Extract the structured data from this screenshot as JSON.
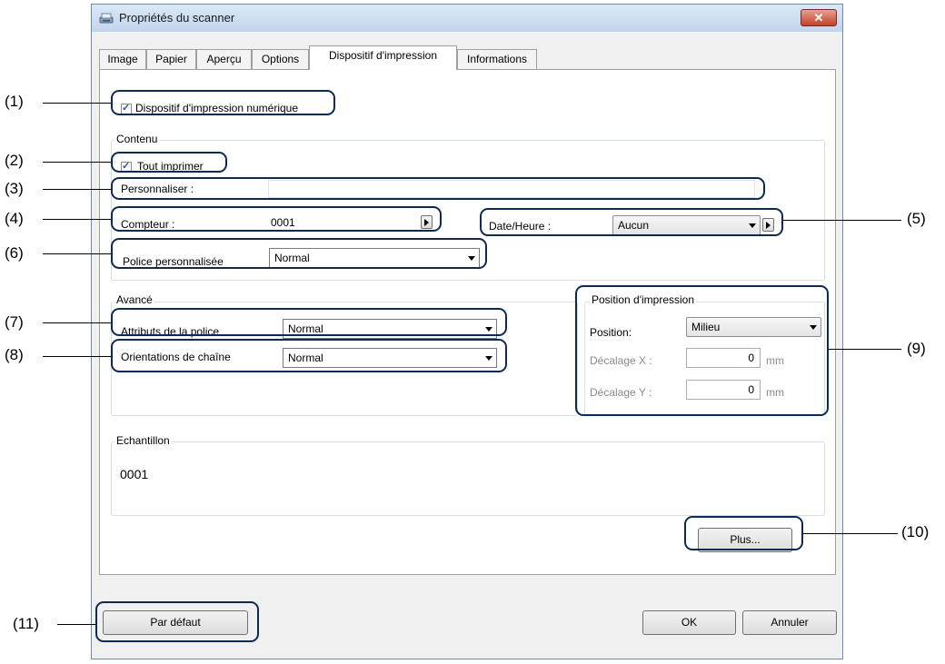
{
  "window": {
    "title": "Propriétés du scanner",
    "close_glyph": "✕"
  },
  "tabs": [
    "Image",
    "Papier",
    "Aperçu",
    "Options",
    "Dispositif d'impression",
    "Informations"
  ],
  "digital_printer": {
    "label": "Dispositif d'impression numérique",
    "checked": true
  },
  "contenu": {
    "title": "Contenu",
    "print_all": {
      "label": "Tout imprimer",
      "checked": true
    },
    "customize": {
      "label": "Personnaliser :",
      "value": ""
    },
    "counter": {
      "label": "Compteur :",
      "value": "0001"
    },
    "datetime": {
      "label": "Date/Heure :",
      "value": "Aucun"
    },
    "custom_font": {
      "label": "Police personnalisée",
      "value": "Normal"
    }
  },
  "avance": {
    "title": "Avancé",
    "font_attributes": {
      "label": "Attributs de la police",
      "value": "Normal"
    },
    "string_orientation": {
      "label": "Orientations de chaîne",
      "value": "Normal"
    }
  },
  "print_position": {
    "title": "Position d'impression",
    "position": {
      "label": "Position:",
      "value": "Milieu"
    },
    "offset_x": {
      "label": "Décalage X :",
      "value": "0",
      "unit": "mm"
    },
    "offset_y": {
      "label": "Décalage Y :",
      "value": "0",
      "unit": "mm"
    }
  },
  "sample": {
    "title": "Echantillon",
    "value": "0001"
  },
  "buttons": {
    "more": "Plus...",
    "default": "Par défaut",
    "ok": "OK",
    "cancel": "Annuler"
  },
  "callouts": [
    "(1)",
    "(2)",
    "(3)",
    "(4)",
    "(5)",
    "(6)",
    "(7)",
    "(8)",
    "(9)",
    "(10)",
    "(11)"
  ]
}
